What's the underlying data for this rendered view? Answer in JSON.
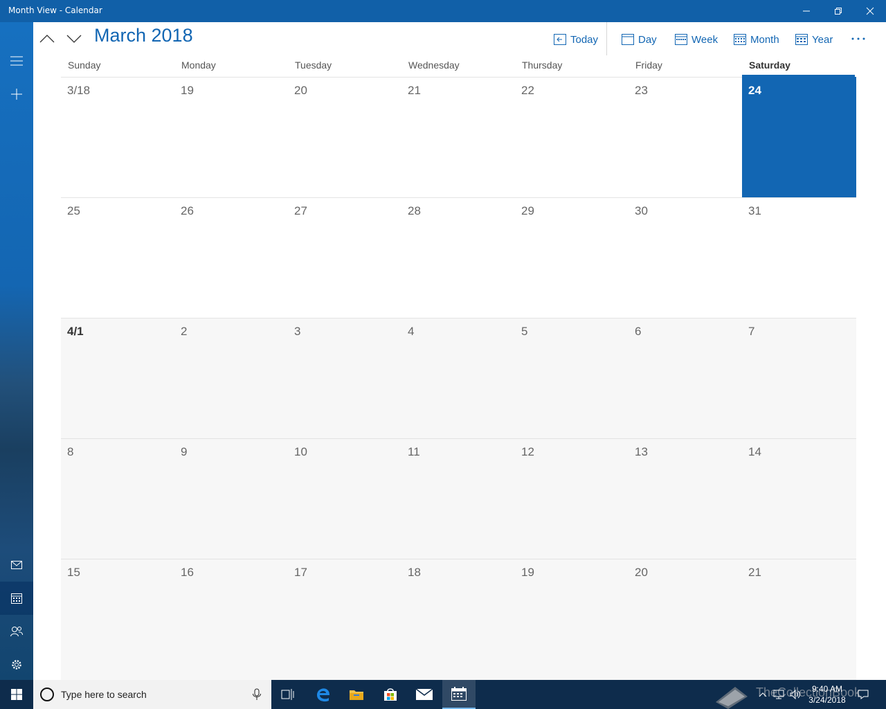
{
  "window": {
    "title": "Month View - Calendar"
  },
  "header": {
    "month_title": "March 2018",
    "toolbar": {
      "today": "Today",
      "day": "Day",
      "week": "Week",
      "month": "Month",
      "year": "Year"
    }
  },
  "day_names": [
    "Sunday",
    "Monday",
    "Tuesday",
    "Wednesday",
    "Thursday",
    "Friday",
    "Saturday"
  ],
  "today_column": 6,
  "weeks": [
    [
      "3/18",
      "19",
      "20",
      "21",
      "22",
      "23",
      "24"
    ],
    [
      "25",
      "26",
      "27",
      "28",
      "29",
      "30",
      "31"
    ],
    [
      "4/1",
      "2",
      "3",
      "4",
      "5",
      "6",
      "7"
    ],
    [
      "8",
      "9",
      "10",
      "11",
      "12",
      "13",
      "14"
    ],
    [
      "15",
      "16",
      "17",
      "18",
      "19",
      "20",
      "21"
    ]
  ],
  "other_month_rows": [
    2,
    3,
    4
  ],
  "today_cell": {
    "row": 0,
    "col": 6
  },
  "taskbar": {
    "search_placeholder": "Type here to search",
    "time": "9:40 AM",
    "date": "3/24/2018"
  },
  "watermark": "TheCollectionBook",
  "colors": {
    "accent": "#1266b3",
    "titlebar": "#1160a8",
    "taskbar": "#0e2c4c"
  }
}
